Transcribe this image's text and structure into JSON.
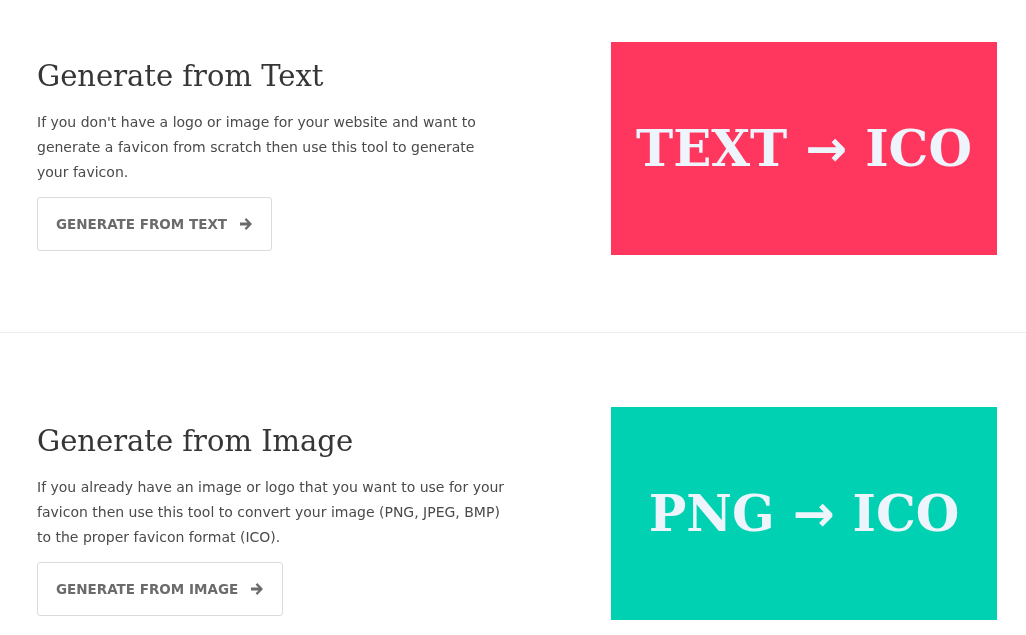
{
  "sections": [
    {
      "heading": "Generate from Text",
      "description": "If you don't have a logo or image for your website and want to generate a favicon from scratch then use this tool to generate your favicon.",
      "button": "GENERATE FROM TEXT",
      "banner": {
        "from": "TEXT",
        "arrow": "→",
        "to": "ICO",
        "color": "#ff365e"
      }
    },
    {
      "heading": "Generate from Image",
      "description": "If you already have an image or logo that you want to use for your favicon then use this tool to convert your image (PNG, JPEG, BMP) to the proper favicon format (ICO).",
      "button": "GENERATE FROM IMAGE",
      "banner": {
        "from": "PNG",
        "arrow": "→",
        "to": "ICO",
        "color": "#00d1b2"
      }
    }
  ]
}
